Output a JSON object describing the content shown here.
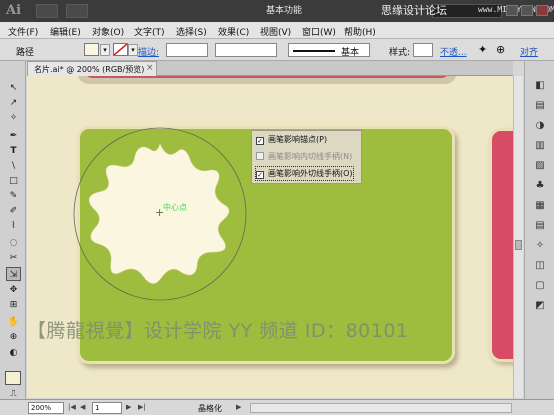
{
  "app": {
    "logo": "Ai",
    "workspace": "基本功能",
    "watermark_top": "思缘设计论坛",
    "watermark_url": "www.MISSYUAN.COM"
  },
  "menu": [
    "文件(F)",
    "编辑(E)",
    "对象(O)",
    "文字(T)",
    "选择(S)",
    "效果(C)",
    "视图(V)",
    "窗口(W)",
    "帮助(H)"
  ],
  "control": {
    "object_type": "路径",
    "stroke_link": "描边:",
    "brush_name": "基本",
    "style_label": "样式:",
    "opacity_link": "不透...",
    "align_link": "对齐"
  },
  "document": {
    "tab_title": "名片.ai* @ 200% (RGB/预览)",
    "tab_close": "×"
  },
  "artwork": {
    "card_green": "#9ebc3e",
    "card_pink": "#d84b65",
    "shape_fill": "#fbf6df",
    "center_label": "中心点",
    "center_cross": "+"
  },
  "options": [
    {
      "label": "画笔影响锚点(P)",
      "checked": true,
      "enabled": true
    },
    {
      "label": "画笔影响内切线手柄(N)",
      "checked": false,
      "enabled": false
    },
    {
      "label": "画笔影响外切线手柄(O)",
      "checked": true,
      "enabled": true
    }
  ],
  "watermark_bottom": "【腾龍視覺】设计学院  YY 频道 ID：80101",
  "status": {
    "zoom": "200%",
    "page": "1",
    "text": "晶格化"
  },
  "tools": [
    "↖",
    "↗",
    "✧",
    "✒",
    "T",
    "\\",
    "□",
    "✎",
    "✐",
    "⌇",
    "◌",
    "✂",
    "⇲",
    "✥",
    "⊞",
    "✋",
    "⊕",
    "◐",
    "⎍",
    "☷",
    "❖",
    "⌕"
  ],
  "dock_icons": [
    "◧",
    "▤",
    "◑",
    "▥",
    "▨",
    "♣",
    "▦",
    "▤",
    "✧",
    "◫",
    "▢",
    "◩"
  ]
}
